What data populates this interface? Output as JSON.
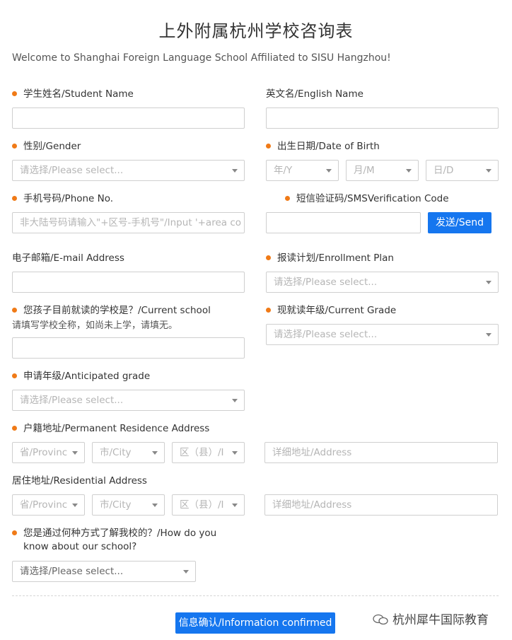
{
  "header": {
    "title": "上外附属杭州学校咨询表",
    "welcome": "Welcome to Shanghai Foreign Language School Affiliated to SISU Hangzhou!"
  },
  "form": {
    "student_name": {
      "label": "学生姓名/Student Name",
      "required": true,
      "value": ""
    },
    "english_name": {
      "label": "英文名/English Name",
      "required": false,
      "value": ""
    },
    "gender": {
      "label": "性别/Gender",
      "required": true,
      "selected": "请选择/Please select..."
    },
    "date_of_birth": {
      "label": "出生日期/Date of Birth",
      "required": true,
      "year": "年/Y",
      "month": "月/M",
      "day": "日/D"
    },
    "phone": {
      "label": "手机号码/Phone No.",
      "required": true,
      "placeholder": "非大陆号码请输入\"+区号-手机号\"/Input '+area co"
    },
    "sms_code": {
      "label": "短信验证码/SMSVerification Code",
      "required": true,
      "value": "",
      "send_button": "发送/Send"
    },
    "email": {
      "label": "电子邮箱/E-mail Address",
      "required": false,
      "value": ""
    },
    "enrollment_plan": {
      "label": "报读计划/Enrollment Plan",
      "required": true,
      "selected": "请选择/Please select..."
    },
    "current_school": {
      "label": "您孩子目前就读的学校是？/Current school",
      "hint": "请填写学校全称，如尚未上学，请填无。",
      "required": true,
      "value": ""
    },
    "current_grade": {
      "label": "现就读年级/Current Grade",
      "required": true,
      "selected": "请选择/Please select..."
    },
    "anticipated_grade": {
      "label": "申请年级/Anticipated grade",
      "required": true,
      "selected": "请选择/Please select..."
    },
    "permanent_address": {
      "label": "户籍地址/Permanent Residence Address",
      "required": true,
      "province": "省/Provinc",
      "city": "市/City",
      "district": "区（县）/I",
      "detail_placeholder": "详细地址/Address"
    },
    "residential_address": {
      "label": "居住地址/Residential Address",
      "required": false,
      "province": "省/Provinc",
      "city": "市/City",
      "district": "区（县）/I",
      "detail_placeholder": "详细地址/Address"
    },
    "how_know": {
      "label_line1": "您是通过何种方式了解我校的？/How do you",
      "label_line2": "know about our school?",
      "required": true,
      "selected": "请选择/Please select..."
    },
    "submit_label": "信息确认/Information confirmed"
  },
  "watermark": {
    "text": "杭州犀牛国际教育"
  },
  "colors": {
    "required_dot": "#f07a17",
    "primary_button": "#1576ef",
    "border": "#cfcfcf",
    "placeholder": "#b5b5b5"
  }
}
